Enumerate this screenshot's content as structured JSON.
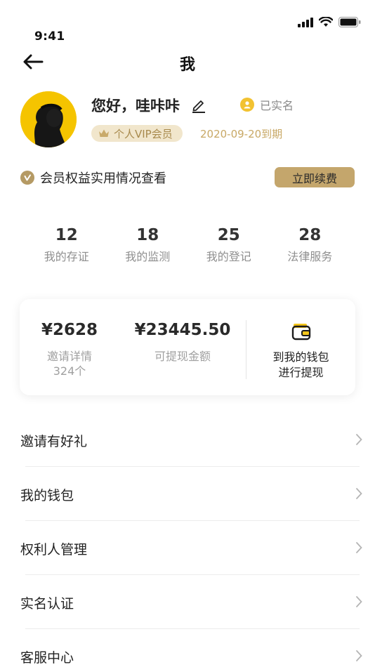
{
  "status": {
    "time": "9:41"
  },
  "nav": {
    "title": "我"
  },
  "profile": {
    "greeting": "您好，哇咔咔",
    "verified_text": "已实名",
    "vip_label": "个人VIP会员",
    "vip_expire": "2020-09-20到期"
  },
  "benefit": {
    "text": "会员权益实用情况查看",
    "renew_label": "立即续费"
  },
  "stats": [
    {
      "value": "12",
      "label": "我的存证"
    },
    {
      "value": "18",
      "label": "我的监测"
    },
    {
      "value": "25",
      "label": "我的登记"
    },
    {
      "value": "28",
      "label": "法律服务"
    }
  ],
  "wallet_card": {
    "invite_amount": "¥2628",
    "invite_label": "邀请详情",
    "invite_count": "324个",
    "withdraw_amount": "¥23445.50",
    "withdraw_label": "可提现金额",
    "wallet_link_line1": "到我的钱包",
    "wallet_link_line2": "进行提现",
    "wallet_icon": "wallet-icon"
  },
  "menu": [
    {
      "label": "邀请有好礼"
    },
    {
      "label": "我的钱包"
    },
    {
      "label": "权利人管理"
    },
    {
      "label": "实名认证"
    },
    {
      "label": "客服中心"
    }
  ],
  "colors": {
    "accent_gold": "#c4a66c",
    "vip_bg": "#f1e6cc",
    "avatar_bg": "#f5c400",
    "verified_yellow": "#f2c231"
  }
}
